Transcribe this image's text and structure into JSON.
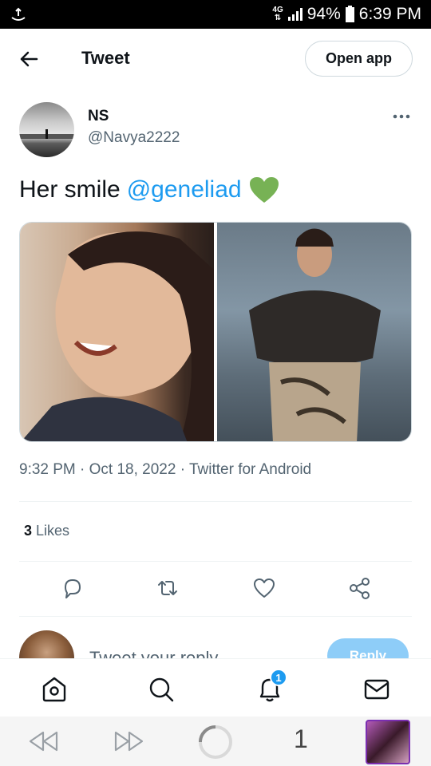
{
  "status_bar": {
    "network": "4G",
    "battery": "94%",
    "time": "6:39 PM"
  },
  "header": {
    "title": "Tweet",
    "open_app_label": "Open app"
  },
  "tweet": {
    "author_name": "NS",
    "author_handle": "@Navya2222",
    "text": "Her smile",
    "mention": "@geneliad",
    "timestamp": "9:32 PM · Oct 18, 2022 · Twitter for Android",
    "likes_count": "3",
    "likes_label": "Likes"
  },
  "reply": {
    "placeholder": "Tweet your reply",
    "button_label": "Reply"
  },
  "bottom_nav": {
    "notifications_badge": "1"
  },
  "browser": {
    "tab_count": "1"
  },
  "colors": {
    "accent": "#1d9bf0",
    "heart_emoji": "#77b255"
  }
}
